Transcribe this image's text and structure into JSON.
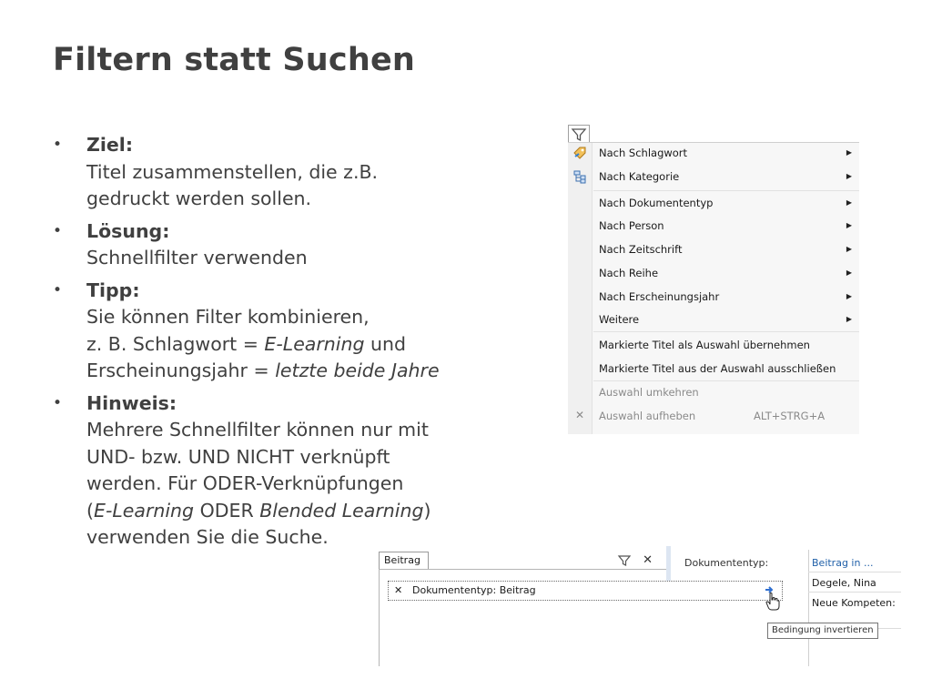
{
  "slide": {
    "title": "Filtern statt Suchen",
    "bullets": [
      {
        "head": "Ziel:",
        "lines": [
          "Titel zusammenstellen, die z.B.",
          "gedruckt werden sollen."
        ]
      },
      {
        "head": "Lösung:",
        "lines": [
          "Schnellfilter verwenden"
        ]
      },
      {
        "head": "Tipp:",
        "line1": "Sie können Filter kombinieren,",
        "line2_pre": "z. B. Schlagwort = ",
        "line2_em": "E-Learning",
        "line2_post": " und",
        "line3_pre": "Erscheinungsjahr = ",
        "line3_em": "letzte beide Jahre"
      },
      {
        "head": "Hinweis:",
        "line1": "Mehrere Schnellfilter können nur mit",
        "line2": "UND- bzw. UND NICHT verknüpft",
        "line3": "werden. Für ODER-Verknüpfungen",
        "line4_open": "(",
        "line4_em1": "E-Learning",
        "line4_mid": " ODER ",
        "line4_em2": "Blended Learning",
        "line4_close": ")",
        "line5": "verwenden Sie die Suche."
      }
    ]
  },
  "context_menu": {
    "items": [
      {
        "label": "Nach Schlagwort",
        "submenu": true,
        "icon": "tag-icon"
      },
      {
        "label": "Nach Kategorie",
        "submenu": true,
        "icon": "category-tree-icon"
      },
      {
        "label": "Nach Dokumententyp",
        "submenu": true
      },
      {
        "label": "Nach Person",
        "submenu": true
      },
      {
        "label": "Nach Zeitschrift",
        "submenu": true
      },
      {
        "label": "Nach Reihe",
        "submenu": true
      },
      {
        "label": "Nach Erscheinungsjahr",
        "submenu": true
      },
      {
        "label": "Weitere",
        "submenu": true
      },
      {
        "label": "Markierte Titel als Auswahl übernehmen"
      },
      {
        "label": "Markierte Titel aus der Auswahl ausschließen"
      },
      {
        "label": "Auswahl umkehren",
        "disabled": true
      },
      {
        "label": "Auswahl aufheben",
        "disabled": true,
        "shortcut": "ALT+STRG+A",
        "icon": "close-icon"
      }
    ]
  },
  "filter_panel": {
    "tab_label": "Beitrag",
    "condition_text": "Dokumententyp: Beitrag",
    "column_header_1": "Dokumententyp:",
    "column_header_2": "Beitrag in ...",
    "cells": [
      "Degele, Nina",
      "Neue Kompeten:"
    ],
    "tooltip": "Bedingung invertieren"
  },
  "colors": {
    "text": "#404040",
    "link_blue": "#1f5fa8",
    "invert_arrow": "#2f6fd0"
  }
}
